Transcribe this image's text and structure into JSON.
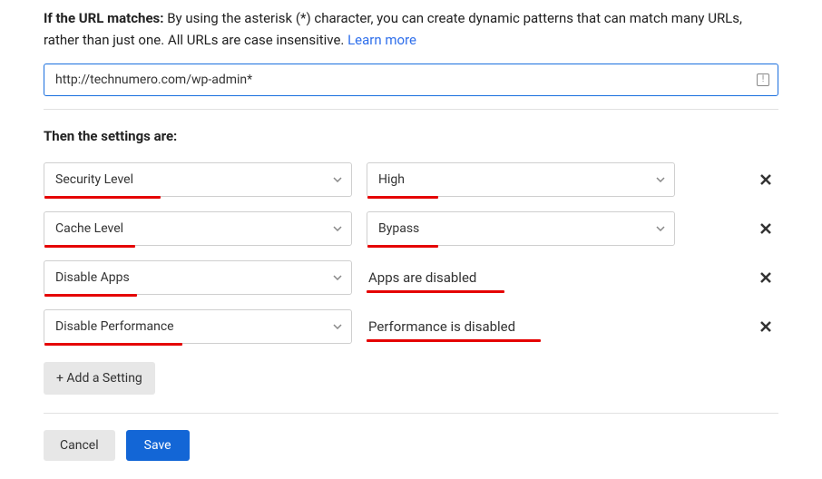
{
  "intro": {
    "label": "If the URL matches:",
    "text_before": " By using the asterisk (*) character, you can create dynamic patterns that can match many URLs, rather than just one. All URLs are case insensitive. ",
    "learn_more": "Learn more"
  },
  "url_input": {
    "value": "http://technumero.com/wp-admin*"
  },
  "section_heading": "Then the settings are:",
  "rows": [
    {
      "setting": "Security Level",
      "setting_underline_width": 128,
      "value_type": "select",
      "value": "High",
      "value_underline_width": 78
    },
    {
      "setting": "Cache Level",
      "setting_underline_width": 100,
      "value_type": "select",
      "value": "Bypass",
      "value_underline_width": 78
    },
    {
      "setting": "Disable Apps",
      "setting_underline_width": 102,
      "value_type": "static",
      "value": "Apps are disabled",
      "value_underline_width": 152
    },
    {
      "setting": "Disable Performance",
      "setting_underline_width": 152,
      "value_type": "static",
      "value": "Performance is disabled",
      "value_underline_width": 192
    }
  ],
  "add_setting_label": "+ Add a Setting",
  "footer": {
    "cancel": "Cancel",
    "save": "Save"
  }
}
